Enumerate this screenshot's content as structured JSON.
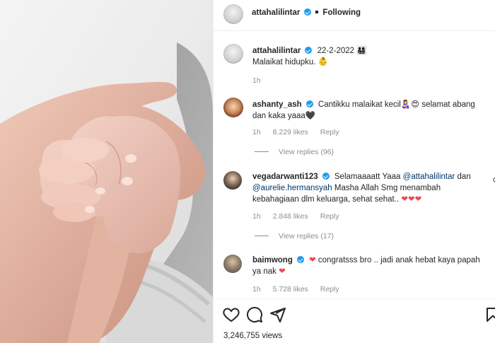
{
  "post": {
    "author": "attahalilintar",
    "follow_status": "Following",
    "caption_date": "22-2-2022 👨‍👩‍👧‍👦",
    "caption_text": "Malaikat hidupku. 👶",
    "caption_time": "1h"
  },
  "comments": [
    {
      "username": "ashanty_ash",
      "text": "Cantikku malaikat kecil👩‍🍼😍 selamat abang dan kaka yaaa🖤",
      "time": "1h",
      "likes": "8.229 likes",
      "reply_label": "Reply",
      "view_replies": "View replies (96)"
    },
    {
      "username": "vegadarwanti123",
      "text_a": "Selamaaaatt Yaaa ",
      "mention_1": "@attahalilintar",
      "text_b": " dan ",
      "mention_2": "@aurelie.hermansyah",
      "text_c": " Masha Allah Smg menambah kebahagiaan dlm keluarga, sehat sehat.. ",
      "hearts": "❤❤❤",
      "time": "1h",
      "likes": "2.848 likes",
      "reply_label": "Reply",
      "view_replies": "View replies (17)"
    },
    {
      "username": "baimwong",
      "heart_prefix": "❤",
      "text": " congratsss bro .. jadi anak hebat kaya papah ya nak ",
      "heart_suffix": "❤",
      "time": "1h",
      "likes": "5.728 likes",
      "reply_label": "Reply"
    }
  ],
  "footer": {
    "views": "3,246,755 views"
  },
  "icons": {
    "like": "heart-outline-icon",
    "comment": "speech-bubble-icon",
    "share": "paper-plane-icon",
    "save": "bookmark-icon",
    "verified": "verified-badge-icon"
  },
  "colors": {
    "verified": "#1d9bf0",
    "heart": "#ed4956",
    "muted": "#8e8e8e",
    "mention": "#00376b"
  }
}
